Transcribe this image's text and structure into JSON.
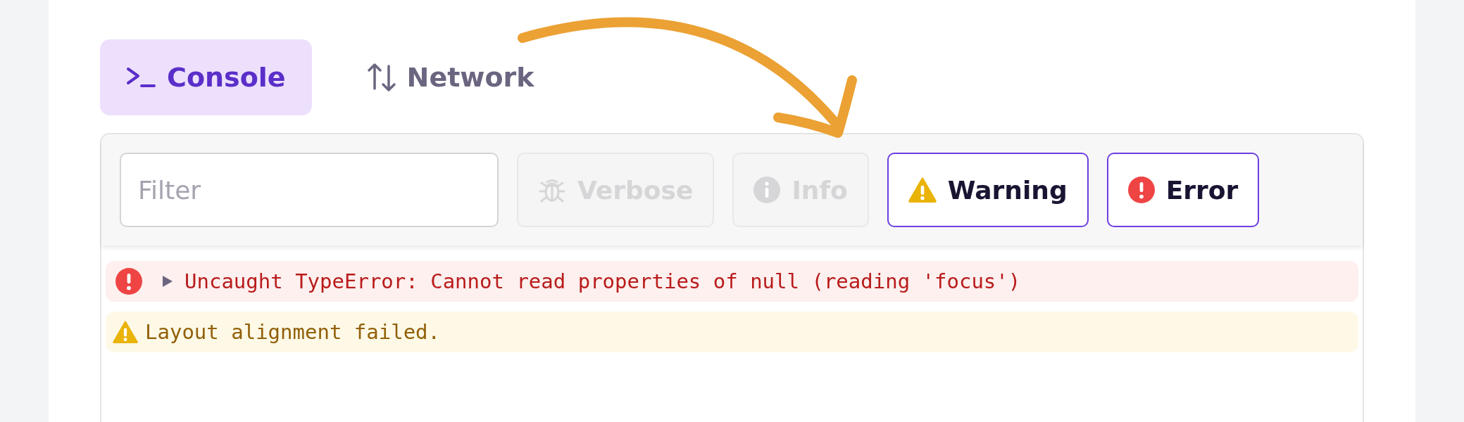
{
  "tabs": [
    {
      "label": "Console",
      "kind": "console",
      "selected": true
    },
    {
      "label": "Network",
      "kind": "network",
      "selected": false
    }
  ],
  "filter": {
    "placeholder": "Filter"
  },
  "levels": [
    {
      "label": "Verbose",
      "kind": "verbose",
      "on": false
    },
    {
      "label": "Info",
      "kind": "info",
      "on": false
    },
    {
      "label": "Warning",
      "kind": "warning",
      "on": true
    },
    {
      "label": "Error",
      "kind": "error",
      "on": true
    }
  ],
  "log": [
    {
      "kind": "error",
      "expanded": false,
      "text": "Uncaught TypeError: Cannot read properties of null (reading 'focus')"
    },
    {
      "kind": "warning",
      "text": "Layout alignment failed."
    }
  ]
}
